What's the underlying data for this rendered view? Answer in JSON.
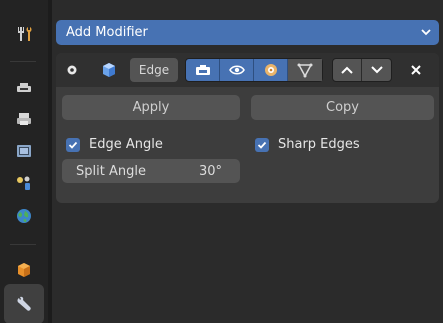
{
  "tabs": {
    "items": [
      {
        "name": "tool",
        "icon": "tool-icon"
      },
      {
        "name": "render",
        "icon": "render-icon"
      },
      {
        "name": "output",
        "icon": "output-icon"
      },
      {
        "name": "view-layer",
        "icon": "view-layer-icon"
      },
      {
        "name": "scene",
        "icon": "scene-icon"
      },
      {
        "name": "world",
        "icon": "world-icon"
      },
      {
        "name": "object",
        "icon": "object-icon"
      },
      {
        "name": "modifiers",
        "icon": "wrench-icon",
        "active": true
      }
    ]
  },
  "add_modifier": {
    "label": "Add Modifier",
    "icon": "chevron-down-icon"
  },
  "modifier": {
    "name": "Edge",
    "icons": {
      "collapse": "circle-dot-icon",
      "type": "edge-split-modifier-icon",
      "edit_mode": "edit-mode-icon",
      "viewport": "eye-icon",
      "render": "camera-icon",
      "on_cage": "on-cage-icon",
      "move_up": "triangle-up-icon",
      "move_down": "triangle-down-icon",
      "remove": "close-icon"
    },
    "toggles": {
      "edit_mode": true,
      "viewport": true,
      "render": true,
      "on_cage": false
    },
    "apply_label": "Apply",
    "copy_label": "Copy",
    "edge_angle": {
      "label": "Edge Angle",
      "checked": true
    },
    "sharp_edges": {
      "label": "Sharp Edges",
      "checked": true
    },
    "split_angle": {
      "label": "Split Angle",
      "value": "30°"
    }
  },
  "colors": {
    "accent": "#4772b3",
    "panel": "#3d3d3d",
    "header": "#303030",
    "widget": "#545454",
    "background": "#2b2b2b"
  }
}
